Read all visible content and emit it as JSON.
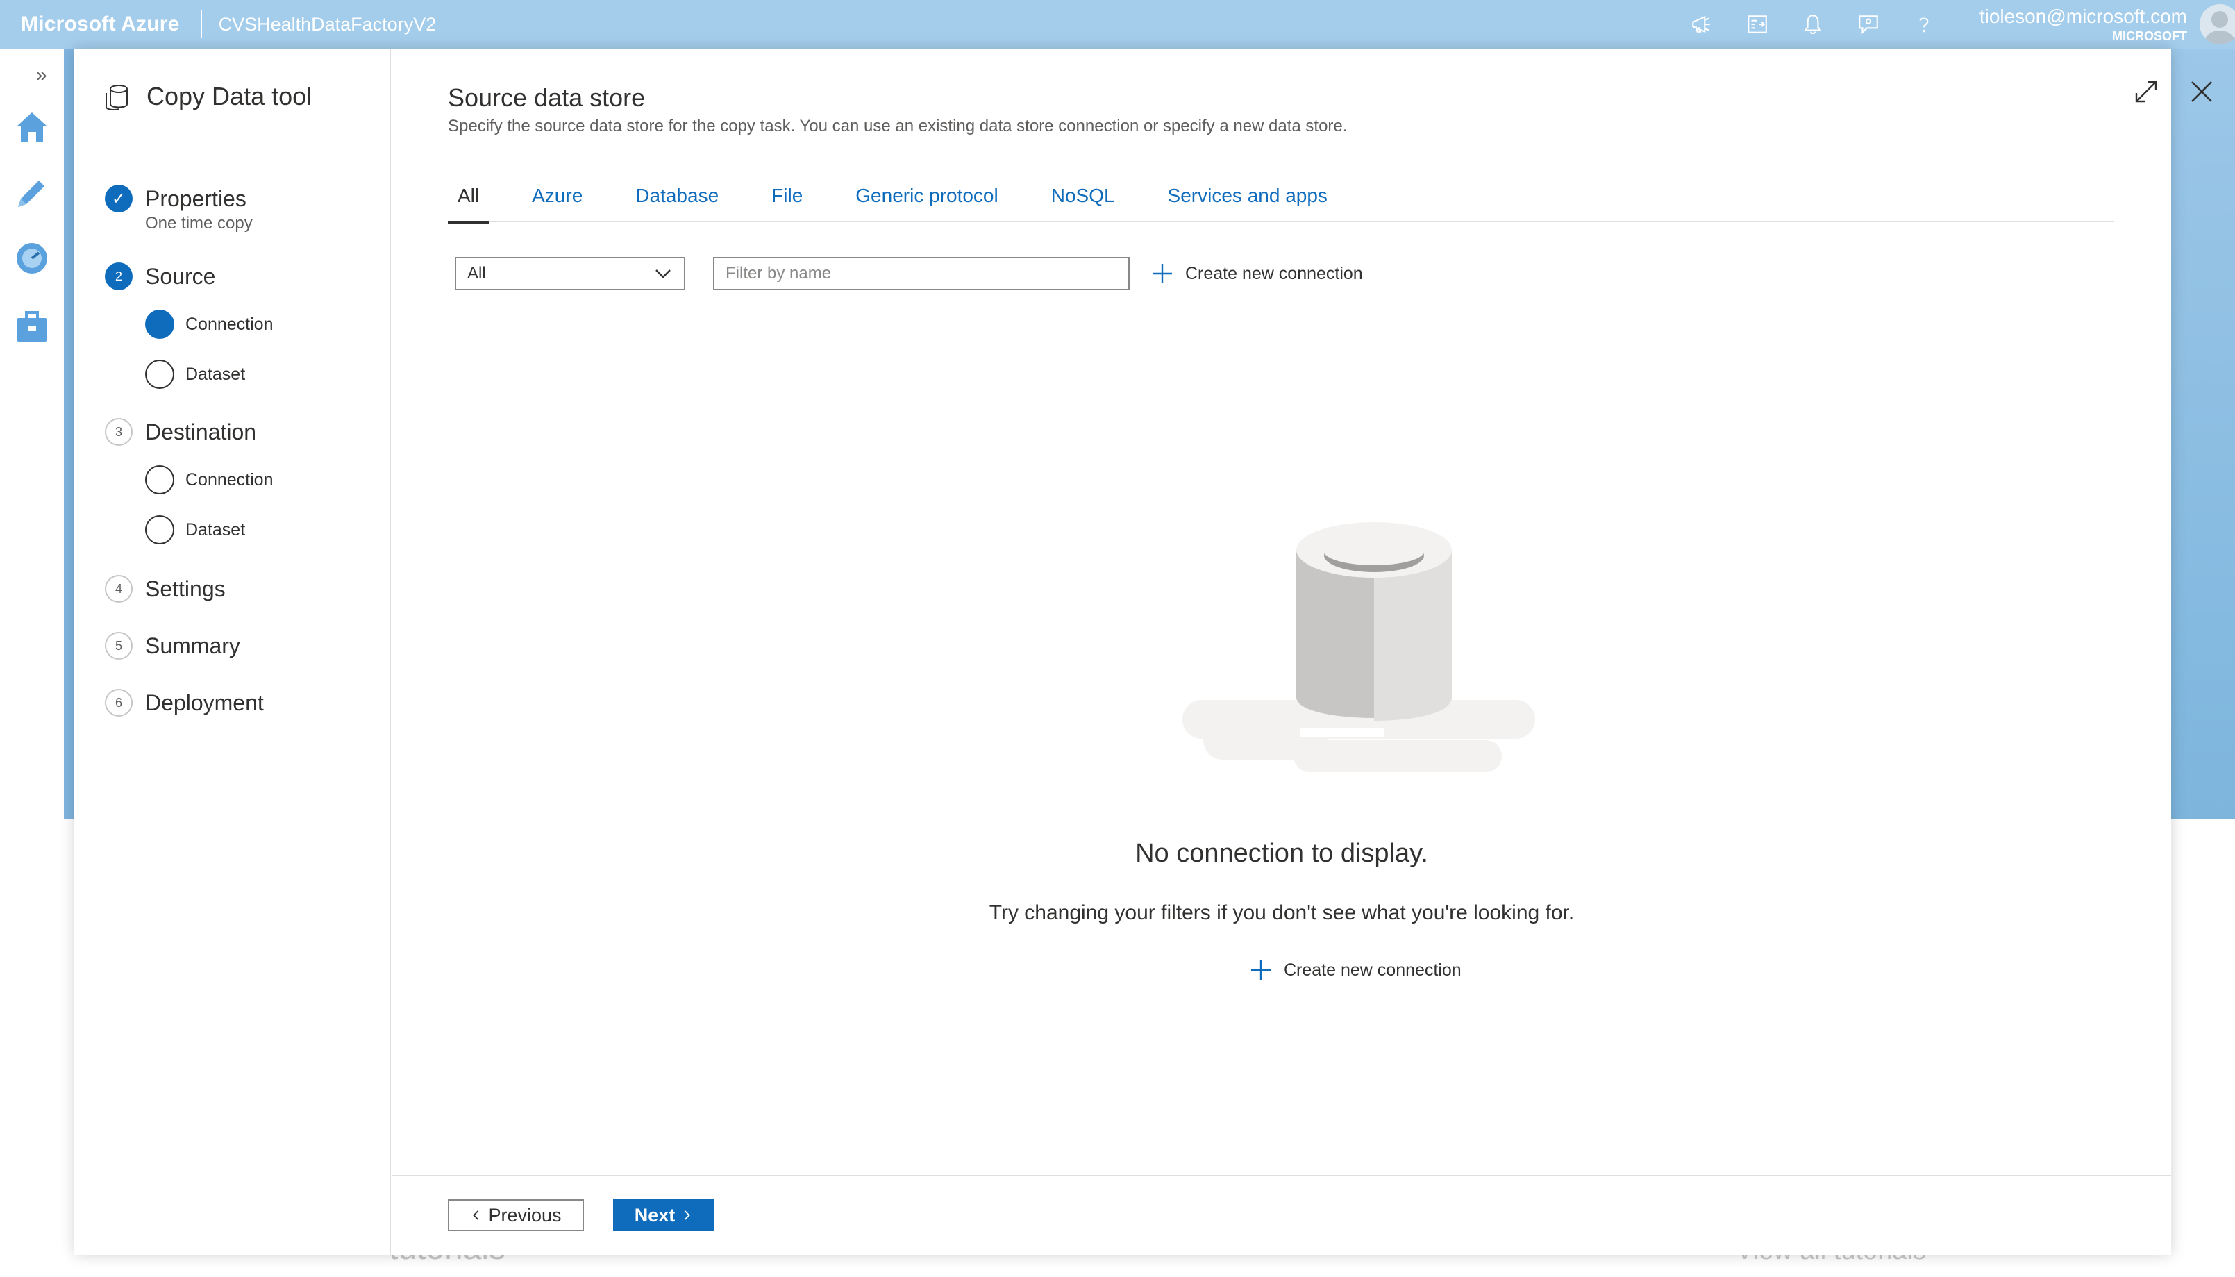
{
  "topbar": {
    "brand": "Microsoft Azure",
    "factory_name": "CVSHealthDataFactoryV2",
    "icons": [
      "announcement-icon",
      "directory-switch-icon",
      "notification-bell-icon",
      "feedback-icon",
      "help-icon"
    ],
    "user_email": "tioleson@microsoft.com",
    "user_org": "MICROSOFT"
  },
  "rail": {
    "expand_glyph": "»",
    "items": [
      "home-icon",
      "author-pencil-icon",
      "monitor-icon",
      "manage-toolbox-icon"
    ]
  },
  "wizard": {
    "title": "Copy Data tool",
    "steps": [
      {
        "number": "✓",
        "label": "Properties",
        "sublabel": "One time copy",
        "state": "done"
      },
      {
        "number": "2",
        "label": "Source",
        "state": "active"
      },
      {
        "number": "3",
        "label": "Destination",
        "state": "todo"
      },
      {
        "number": "4",
        "label": "Settings",
        "state": "todo"
      },
      {
        "number": "5",
        "label": "Summary",
        "state": "todo"
      },
      {
        "number": "6",
        "label": "Deployment",
        "state": "todo"
      }
    ],
    "source_substeps": [
      {
        "label": "Connection",
        "selected": true
      },
      {
        "label": "Dataset",
        "selected": false
      }
    ],
    "destination_substeps": [
      {
        "label": "Connection",
        "selected": false
      },
      {
        "label": "Dataset",
        "selected": false
      }
    ]
  },
  "main": {
    "title": "Source data store",
    "description": "Specify the source data store for the copy task. You can use an existing data store connection or specify a new data store.",
    "tabs": [
      {
        "label": "All",
        "selected": true
      },
      {
        "label": "Azure"
      },
      {
        "label": "Database"
      },
      {
        "label": "File"
      },
      {
        "label": "Generic protocol"
      },
      {
        "label": "NoSQL"
      },
      {
        "label": "Services and apps"
      }
    ],
    "type_filter_value": "All",
    "name_filter_placeholder": "Filter by name",
    "create_connection_label": "Create new connection",
    "empty_title": "No connection to display.",
    "empty_description": "Try changing your filters if you don't see what you're looking for.",
    "empty_create_label": "Create new connection"
  },
  "footer": {
    "previous_label": "Previous",
    "next_label": "Next"
  },
  "background": {
    "left_text": "tutorials",
    "right_text": "View all tutorials"
  },
  "colors": {
    "topbar": "#a4cdec",
    "accent": "#0f6cbd",
    "background_band": "#7fb4df"
  }
}
